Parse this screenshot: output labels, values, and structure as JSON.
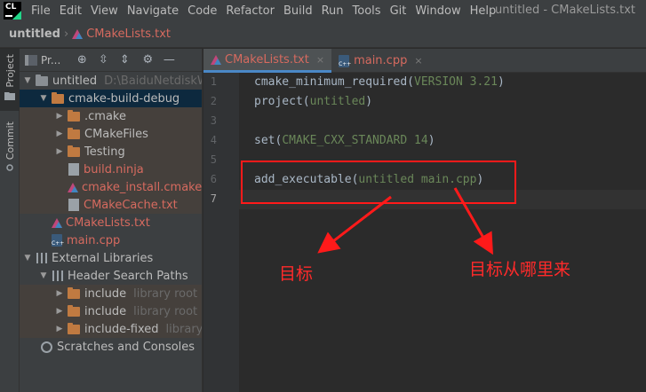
{
  "menubar": {
    "app_logo": "CL",
    "items": [
      "File",
      "Edit",
      "View",
      "Navigate",
      "Code",
      "Refactor",
      "Build",
      "Run",
      "Tools",
      "Git",
      "Window",
      "Help"
    ],
    "window_title": "untitled - CMakeLists.txt"
  },
  "navbar": {
    "project": "untitled",
    "file": "CMakeLists.txt"
  },
  "left_stripe": {
    "project_label": "Project",
    "commit_label": "Commit"
  },
  "project_panel": {
    "title": "Pr...",
    "tree": [
      {
        "label": "untitled",
        "hint": "D:\\BaiduNetdiskWo"
      },
      {
        "label": "cmake-build-debug"
      },
      {
        "label": ".cmake"
      },
      {
        "label": "CMakeFiles"
      },
      {
        "label": "Testing"
      },
      {
        "label": "build.ninja"
      },
      {
        "label": "cmake_install.cmake"
      },
      {
        "label": "CMakeCache.txt"
      },
      {
        "label": "CMakeLists.txt"
      },
      {
        "label": "main.cpp"
      },
      {
        "label": "External Libraries"
      },
      {
        "label": "Header Search Paths"
      },
      {
        "label": "include",
        "hint": "library root"
      },
      {
        "label": "include",
        "hint": "library root"
      },
      {
        "label": "include-fixed",
        "hint": "library r"
      },
      {
        "label": "Scratches and Consoles"
      }
    ]
  },
  "editor": {
    "tabs": [
      {
        "label": "CMakeLists.txt",
        "close": "×"
      },
      {
        "label": "main.cpp",
        "close": "×"
      }
    ],
    "line_numbers": [
      "1",
      "2",
      "3",
      "4",
      "5",
      "6",
      "7"
    ],
    "lines": [
      {
        "fn": "cmake_minimum_required(",
        "arg": "VERSION 3.21",
        "end": ")"
      },
      {
        "fn": "project(",
        "arg": "untitled",
        "end": ")"
      },
      {
        "fn": "",
        "arg": "",
        "end": ""
      },
      {
        "fn": "set(",
        "arg": "CMAKE_CXX_STANDARD 14",
        "end": ")"
      },
      {
        "fn": "",
        "arg": "",
        "end": ""
      },
      {
        "fn": "add_executable(",
        "arg": "untitled main.cpp",
        "end": ")"
      },
      {
        "fn": "",
        "arg": "",
        "end": ""
      }
    ]
  },
  "annotations": {
    "label_target": "目标",
    "label_source": "目标从哪里来",
    "color": "#ff1a1a"
  }
}
